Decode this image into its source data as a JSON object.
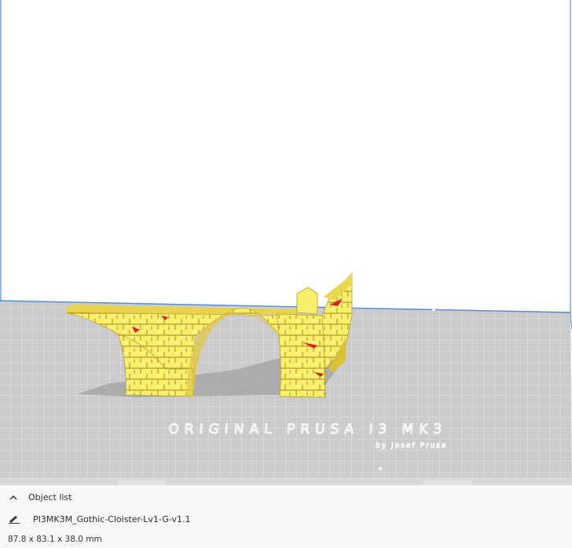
{
  "viewport": {
    "plate_brand": "ORIGINAL PRUSA i3 MK3",
    "plate_sub": "by Josef Prusa",
    "colors": {
      "background": "#ffffff",
      "plate": "#cbcbcb",
      "grid": "#ffffff",
      "volume_edge": "#4f8be0",
      "model": "#f7f26a",
      "model_shade": "#d9c23a",
      "overhang": "#d9202a",
      "shadow": "#a9a9a9"
    }
  },
  "object_list": {
    "header": "Object list",
    "icon": "chevron-up-icon"
  },
  "object": {
    "name": "PI3MK3M_Gothic-Cloister-Lv1-G-v1.1",
    "icon": "pencil-icon",
    "dimensions": "87.8 x 83.1 x 38.0 mm"
  }
}
